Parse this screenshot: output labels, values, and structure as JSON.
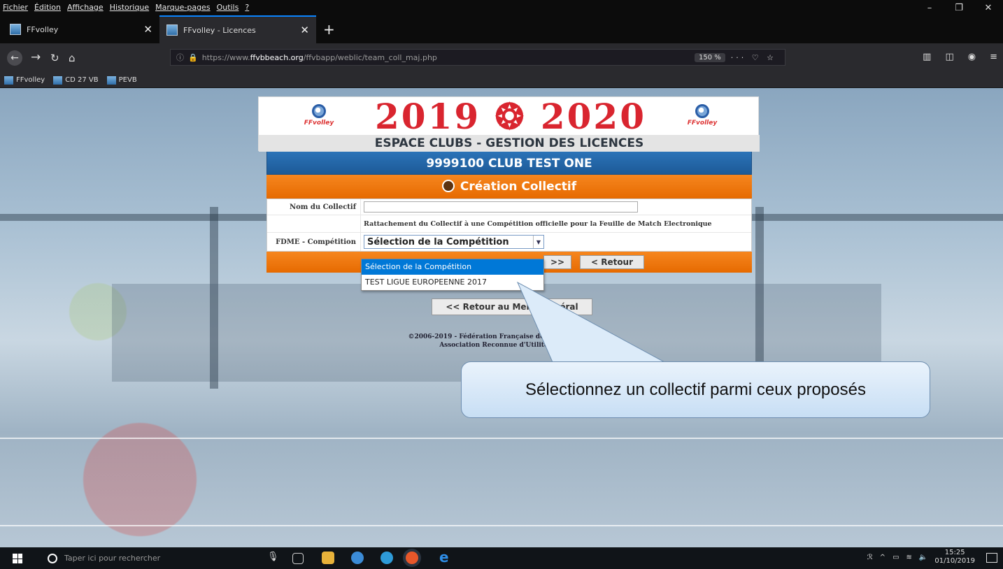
{
  "browser": {
    "menu": [
      "Fichier",
      "Édition",
      "Affichage",
      "Historique",
      "Marque-pages",
      "Outils",
      "?"
    ],
    "tabs": [
      {
        "title": "FFvolley"
      },
      {
        "title": "FFvolley - Licences"
      }
    ],
    "url": {
      "prefix": "https://www.",
      "host": "ffvbbeach.org",
      "path": "/ffvbapp/weblic/team_coll_maj.php"
    },
    "zoom": "150 %",
    "bookmarks": [
      "FFvolley",
      "CD 27 VB",
      "PEVB"
    ]
  },
  "page": {
    "logo_text": "FFvolley",
    "season": "2019 ❂ 2020",
    "subtitle": "ESPACE CLUBS - GESTION DES LICENCES",
    "club": "9999100 CLUB TEST ONE",
    "section": "Création Collectif",
    "form": {
      "nom_label": "Nom du Collectif",
      "nom_value": "",
      "rattachement": "Rattachement du Collectif à une Compétition officielle pour la Feuille de Match Electronique",
      "fdme_label": "FDME - Compétition",
      "select_value": "Sélection de la Compétition"
    },
    "buttons": {
      "next": ">>",
      "retour": "< Retour",
      "retour_menu": "<< Retour au Menu Général"
    },
    "dropdown_options": [
      {
        "label": "Sélection de la Compétition",
        "selected": true
      },
      {
        "label": "TEST LIGUE EUROPEENNE 2017",
        "selected": false
      }
    ],
    "copyright_line1": "©2006-2019 - Fédération Française de Volley - ffvolley.org",
    "copyright_line2": "Association Reconnue d'Utilité Publique"
  },
  "callout": {
    "text": "Sélectionnez un collectif parmi ceux proposés"
  },
  "taskbar": {
    "search_placeholder": "Taper ici pour rechercher",
    "time": "15:25",
    "date": "01/10/2019"
  }
}
